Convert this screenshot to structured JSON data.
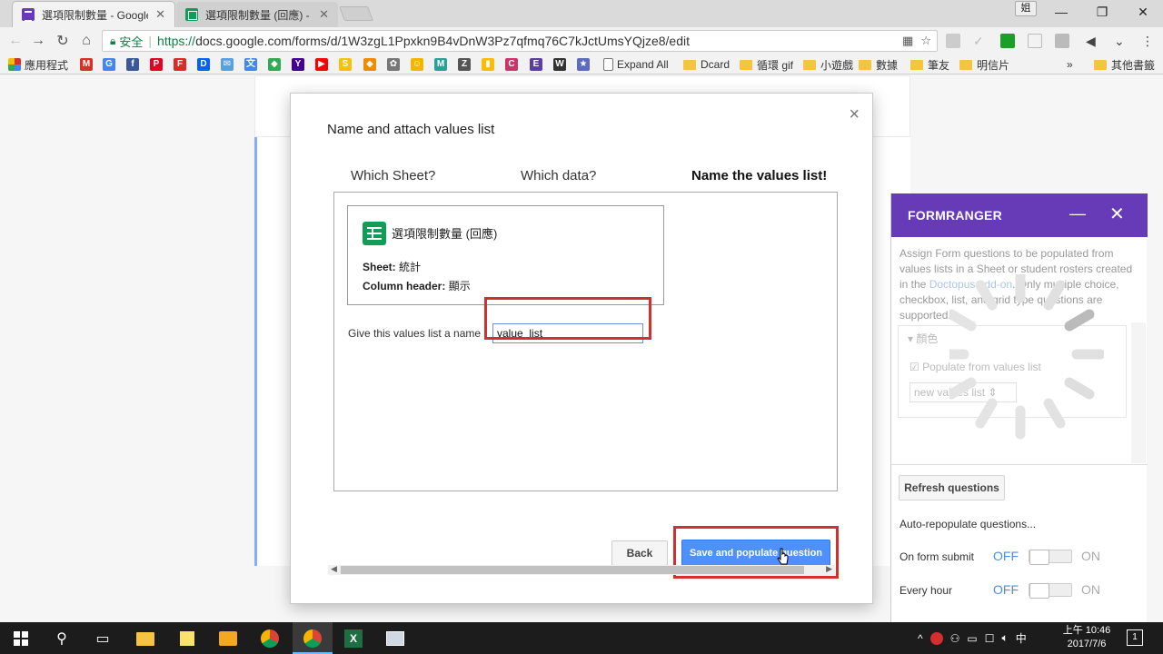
{
  "browser": {
    "tabs": [
      {
        "title": "選項限制數量 - Google",
        "close": "✕",
        "icon": "forms-icon"
      },
      {
        "title": "選項限制數量 (回應) - G",
        "close": "✕",
        "icon": "sheets-icon"
      }
    ],
    "user_badge": "姐",
    "window_controls": {
      "minimize": "—",
      "maximize": "❐",
      "close": "✕"
    },
    "secure_label": "安全",
    "url_protocol": "https://",
    "url_rest": "docs.google.com/forms/d/1W3zgL1Ppxkn9B4vDnW3Pz7qfmq76C7kJctUmsYQjze8/edit",
    "bookmarks": [
      {
        "label": "應用程式",
        "icon": "apps-icon"
      },
      {
        "label": "",
        "icon": "gmail-icon",
        "color": "#d93025",
        "glyph": "M"
      },
      {
        "label": "",
        "icon": "google-icon",
        "color": "#4285f4",
        "glyph": "G"
      },
      {
        "label": "",
        "icon": "facebook-icon",
        "color": "#3b5998",
        "glyph": "f"
      },
      {
        "label": "",
        "icon": "pinterest-icon",
        "color": "#e60023",
        "glyph": "P"
      },
      {
        "label": "",
        "icon": "flipboard-icon",
        "color": "#e12828",
        "glyph": "F"
      },
      {
        "label": "",
        "icon": "dropbox-icon",
        "color": "#0061ff",
        "glyph": "D"
      },
      {
        "label": "",
        "icon": "mail-icon",
        "color": "#5aa0e0",
        "glyph": "✉"
      },
      {
        "label": "",
        "icon": "translate-icon",
        "color": "#4285f4",
        "glyph": "文"
      },
      {
        "label": "",
        "icon": "maps-icon",
        "color": "#34a853",
        "glyph": "◆"
      },
      {
        "label": "",
        "icon": "yahoo-icon",
        "color": "#410093",
        "glyph": "Y"
      },
      {
        "label": "",
        "icon": "youtube-icon",
        "color": "#ff0000",
        "glyph": "▶"
      },
      {
        "label": "",
        "icon": "s-icon",
        "color": "#f4c20d",
        "glyph": "S"
      },
      {
        "label": "",
        "icon": "bookmark-ext-icon",
        "color": "#f28b00",
        "glyph": "◆"
      },
      {
        "label": "",
        "icon": "animal-icon",
        "color": "#777777",
        "glyph": "✿"
      },
      {
        "label": "",
        "icon": "smile-icon",
        "color": "#f5b400",
        "glyph": "☺"
      },
      {
        "label": "",
        "icon": "m-icon",
        "color": "#2aa198",
        "glyph": "M"
      },
      {
        "label": "",
        "icon": "z-icon",
        "color": "#555555",
        "glyph": "Z"
      },
      {
        "label": "",
        "icon": "keep-icon",
        "color": "#fbbc04",
        "glyph": "▮"
      },
      {
        "label": "",
        "icon": "c-icon",
        "color": "#cc3366",
        "glyph": "C"
      },
      {
        "label": "",
        "icon": "e-icon",
        "color": "#5b3fa0",
        "glyph": "E"
      },
      {
        "label": "",
        "icon": "wiki-icon",
        "color": "#333333",
        "glyph": "W"
      },
      {
        "label": "",
        "icon": "star-icon",
        "color": "#5c6bc0",
        "glyph": "★"
      },
      {
        "label": "Expand All",
        "icon": "page-icon"
      },
      {
        "label": "Dcard",
        "icon": "folder-icon"
      },
      {
        "label": "循環 gif",
        "icon": "folder-icon"
      },
      {
        "label": "小遊戲",
        "icon": "folder-icon"
      },
      {
        "label": "數據",
        "icon": "folder-icon"
      },
      {
        "label": "筆友",
        "icon": "folder-icon"
      },
      {
        "label": "明信片",
        "icon": "folder-icon"
      }
    ],
    "bookmarks_more": "»",
    "other_bookmarks": "其他書籤"
  },
  "dialog": {
    "title": "Name and attach values list",
    "close": "×",
    "steps": [
      "Which Sheet?",
      "Which data?",
      "Name the values list!"
    ],
    "sheet_name": "選項限制數量 (回應)",
    "sheet_label": "Sheet:",
    "sheet_value": "統計",
    "column_label": "Column header:",
    "column_value": "顯示",
    "name_label": "Give this values list a name",
    "name_value": "value_list",
    "back_button": "Back",
    "save_button": "Save and populate question"
  },
  "sidebar": {
    "title": "FORMRANGER",
    "minimize": "—",
    "close": "✕",
    "desc_1": "Assign Form questions to be populated from values lists in a Sheet or student rosters created in the ",
    "desc_link": "Doctopus add-on",
    "desc_2": ". Only multiple choice, checkbox, list, and grid type questions are supported.",
    "question_title": "▾  顏色",
    "populate_label": "☑  Populate from values list",
    "values_select": "new values list ⇕",
    "refresh_button": "Refresh questions",
    "auto_label": "Auto-repopulate questions...",
    "toggles": [
      {
        "label": "On form submit",
        "off": "OFF",
        "on": "ON"
      },
      {
        "label": "Every hour",
        "off": "OFF",
        "on": "ON"
      }
    ]
  },
  "taskbar": {
    "clock_time": "上午 10:46",
    "clock_date": "2017/7/6",
    "ime": "中",
    "notifications": "1"
  }
}
